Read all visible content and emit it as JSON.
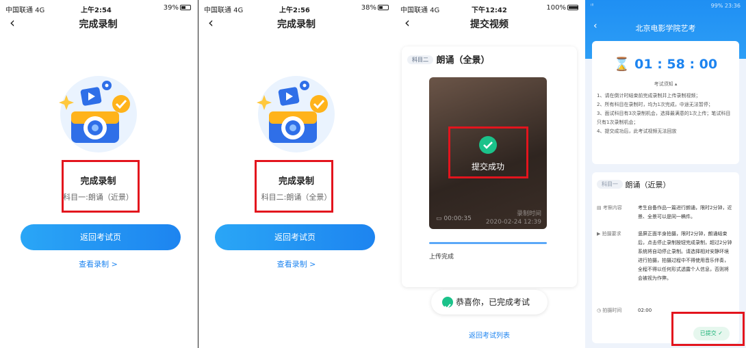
{
  "phone1": {
    "status": {
      "carrier": "中国联通 4G",
      "time": "上午2:54",
      "battery": "39%"
    },
    "nav_title": "完成录制",
    "done_title": "完成录制",
    "done_sub": "科目一:朗诵（近景）",
    "primary_button": "返回考试页",
    "view_link": "查看录制 >"
  },
  "phone2": {
    "status": {
      "carrier": "中国联通 4G",
      "time": "上午2:56",
      "battery": "38%"
    },
    "nav_title": "完成录制",
    "done_title": "完成录制",
    "done_sub": "科目二:朗诵（全景）",
    "primary_button": "返回考试页",
    "view_link": "查看录制 >"
  },
  "phone3": {
    "status": {
      "carrier": "中国联通 4G",
      "time": "下午12:42",
      "battery": "100%"
    },
    "nav_title": "提交视频",
    "subject_tag": "科目二",
    "subject_title": "朗诵（全景）",
    "overlay_text": "提交成功",
    "duration": "00:00:35",
    "record_label": "录制时间",
    "record_time": "2020-02-24 12:39",
    "upload_text": "上传完成",
    "congrats": "恭喜你，已完成考试",
    "return_link": "返回考试列表"
  },
  "phone4": {
    "status_left": "ᴵˡˡ",
    "status_right": "99% 23:36",
    "header_title": "北京电影学院艺考",
    "timer": "01 : 58 : 00",
    "notice": "考试须知 ▴",
    "rules": [
      "1、请在倒计时结束前完成录制并上传录制视频；",
      "2、所有科目在录制时，均为1次完成，中途无法暂停；",
      "3、面试科目有3次录制机会，选择最满意的1次上传；笔试科目只有1次录制机会；",
      "4、提交成功后，此考试视频无法回放"
    ],
    "subject_tag": "科目一",
    "subject_title": "朗诵（近景）",
    "content_key": "考察内容",
    "content_val": "考生自备作品一篇进行朗诵，限时2分钟，近景、全景可以是同一稿件。",
    "req_key": "拍摄要求",
    "req_val": "竖屏正面半身拍摄，限时2分钟，朗诵结束后，点击停止录制按钮完成录制，超过2分钟系统将自动停止录制。请选择相对安静环境进行拍摄，拍摄过程中不得使用音乐伴奏，全程不得以任何形式透露个人信息，否则将会被视为作弊。",
    "time_key": "拍摄时间",
    "time_val": "02:00",
    "submitted": "已提交 ✓"
  },
  "colors": {
    "accent_blue": "#1d84f0",
    "success_green": "#1bc28a",
    "highlight_red": "#e3141d"
  }
}
